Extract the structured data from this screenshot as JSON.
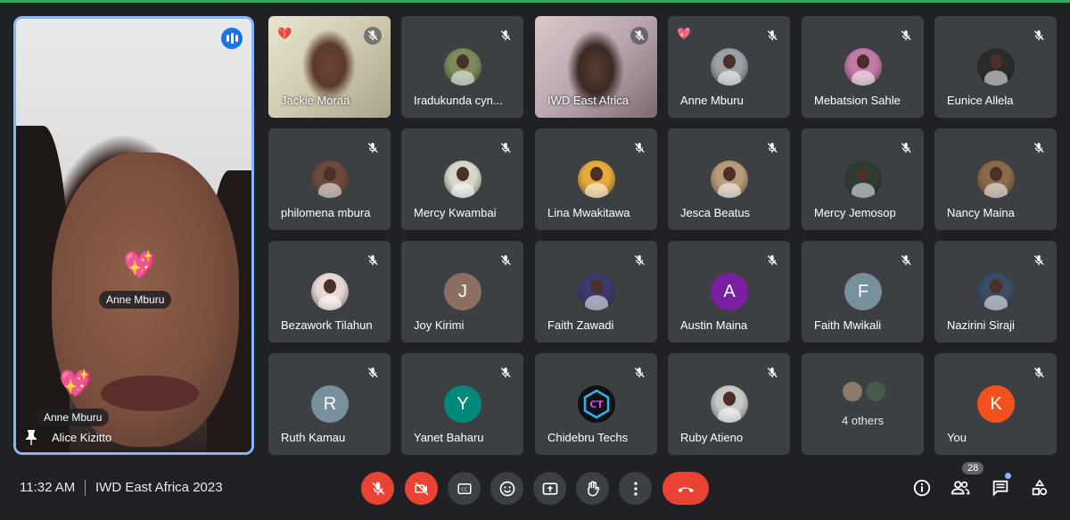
{
  "featured": {
    "name": "Alice Kizitto",
    "reactions": [
      {
        "emoji": "💖",
        "label": "Anne Mburu"
      },
      {
        "emoji": "💖",
        "label": "Anne Mburu"
      }
    ]
  },
  "participants": [
    {
      "name": "Jackie Moraa",
      "kind": "video",
      "heart": "💔"
    },
    {
      "name": "Iradukunda cyn...",
      "kind": "photo",
      "color": "#7a8a5a"
    },
    {
      "name": "IWD East Africa",
      "kind": "video"
    },
    {
      "name": "Anne Mburu",
      "kind": "photo",
      "color": "#9aa0a6",
      "heart": "💖"
    },
    {
      "name": "Mebatsion Sahle",
      "kind": "photo",
      "color": "#c27aa6"
    },
    {
      "name": "Eunice Allela",
      "kind": "photo",
      "color": "#2b2b2b"
    },
    {
      "name": "philomena mbura",
      "kind": "photo",
      "color": "#6b4a3a"
    },
    {
      "name": "Mercy Kwambai",
      "kind": "photo",
      "color": "#d6d6c8"
    },
    {
      "name": "Lina Mwakitawa",
      "kind": "photo",
      "color": "#e6a93a"
    },
    {
      "name": "Jesca Beatus",
      "kind": "photo",
      "color": "#b59b7a"
    },
    {
      "name": "Mercy Jemosop",
      "kind": "photo",
      "color": "#2e3b33"
    },
    {
      "name": "Nancy Maina",
      "kind": "photo",
      "color": "#8a6a4a"
    },
    {
      "name": "Bezawork Tilahun",
      "kind": "photo",
      "color": "#e9d7d5"
    },
    {
      "name": "Joy Kirimi",
      "kind": "letter",
      "letter": "J",
      "color": "#8d6e63"
    },
    {
      "name": "Faith Zawadi",
      "kind": "photo",
      "color": "#3b3a6a"
    },
    {
      "name": "Austin Maina",
      "kind": "letter",
      "letter": "A",
      "color": "#7b1fa2"
    },
    {
      "name": "Faith Mwikali",
      "kind": "letter",
      "letter": "F",
      "color": "#78909c"
    },
    {
      "name": "Nazirini Siraji",
      "kind": "photo",
      "color": "#3a4d63"
    },
    {
      "name": "Ruth Kamau",
      "kind": "letter",
      "letter": "R",
      "color": "#78909c"
    },
    {
      "name": "Yanet Baharu",
      "kind": "letter",
      "letter": "Y",
      "color": "#00897b"
    },
    {
      "name": "Chidebru Techs",
      "kind": "logo",
      "color": "#111"
    },
    {
      "name": "Ruby Atieno",
      "kind": "photo",
      "color": "#c8c8c8"
    },
    {
      "name": "",
      "kind": "others",
      "label": "4 others"
    },
    {
      "name": "You",
      "kind": "letter",
      "letter": "K",
      "color": "#f4511e"
    }
  ],
  "bottom_bar": {
    "time": "11:32 AM",
    "meeting_title": "IWD East Africa 2023",
    "people_count": "28"
  },
  "icons": {
    "mic": "mic-off-icon",
    "camera": "videocam-off-icon",
    "captions": "closed-caption-icon",
    "emoji": "emoji-icon",
    "present": "present-screen-icon",
    "hand": "raise-hand-icon",
    "more": "more-vert-icon",
    "hangup": "call-end-icon",
    "info": "info-icon",
    "people": "people-icon",
    "chat": "chat-icon",
    "activities": "activities-icon"
  },
  "colors": {
    "background": "#202124",
    "tile": "#3c4043",
    "danger": "#ea4335",
    "accent": "#8ab4f8"
  }
}
